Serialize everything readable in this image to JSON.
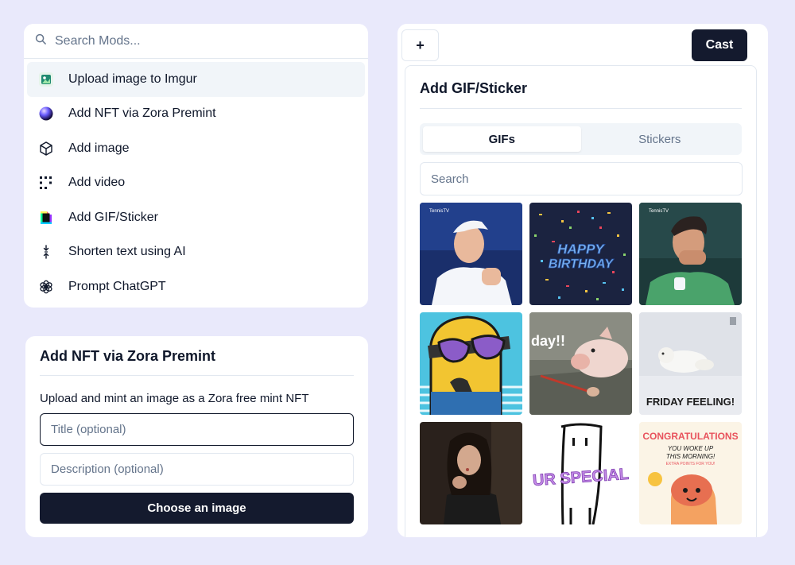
{
  "mods": {
    "search_placeholder": "Search Mods...",
    "items": [
      {
        "label": "Upload image to Imgur",
        "icon": "imgur-icon"
      },
      {
        "label": "Add NFT via Zora Premint",
        "icon": "zora-orb-icon"
      },
      {
        "label": "Add image",
        "icon": "cube-icon"
      },
      {
        "label": "Add video",
        "icon": "video-dots-icon"
      },
      {
        "label": "Add GIF/Sticker",
        "icon": "giphy-icon"
      },
      {
        "label": "Shorten text using AI",
        "icon": "compress-arrows-icon"
      },
      {
        "label": "Prompt ChatGPT",
        "icon": "openai-icon"
      }
    ]
  },
  "zora": {
    "title": "Add NFT via Zora Premint",
    "description": "Upload and mint an image as a Zora free mint NFT",
    "title_placeholder": "Title (optional)",
    "description_placeholder": "Description (optional)",
    "choose_label": "Choose an image"
  },
  "composer": {
    "plus_label": "+",
    "cast_label": "Cast"
  },
  "gif_panel": {
    "title": "Add GIF/Sticker",
    "tabs": [
      "GIFs",
      "Stickers"
    ],
    "active_tab": "GIFs",
    "search_placeholder": "Search",
    "tiles": [
      {
        "name": "tennis-player-gif",
        "caption": "TennisTV"
      },
      {
        "name": "happy-birthday-gif",
        "caption": "HAPPY BIRTHDAY"
      },
      {
        "name": "tennis-celebration-gif",
        "caption": "TennisTV"
      },
      {
        "name": "minion-sunglasses-gif",
        "caption": ""
      },
      {
        "name": "pig-day-gif",
        "caption": "day!!"
      },
      {
        "name": "friday-feeling-gif",
        "caption": "FRIDAY FEELING!"
      },
      {
        "name": "woman-blowing-kiss-gif",
        "caption": ""
      },
      {
        "name": "ur-special-sticker-gif",
        "caption": "UR SPECIAL"
      },
      {
        "name": "congratulations-gif",
        "caption": "CONGRATULATIONS",
        "sub1": "YOU WOKE UP",
        "sub2": "THIS MORNING!",
        "sub3": "EXTRA POINTS FOR YOU!"
      }
    ]
  }
}
